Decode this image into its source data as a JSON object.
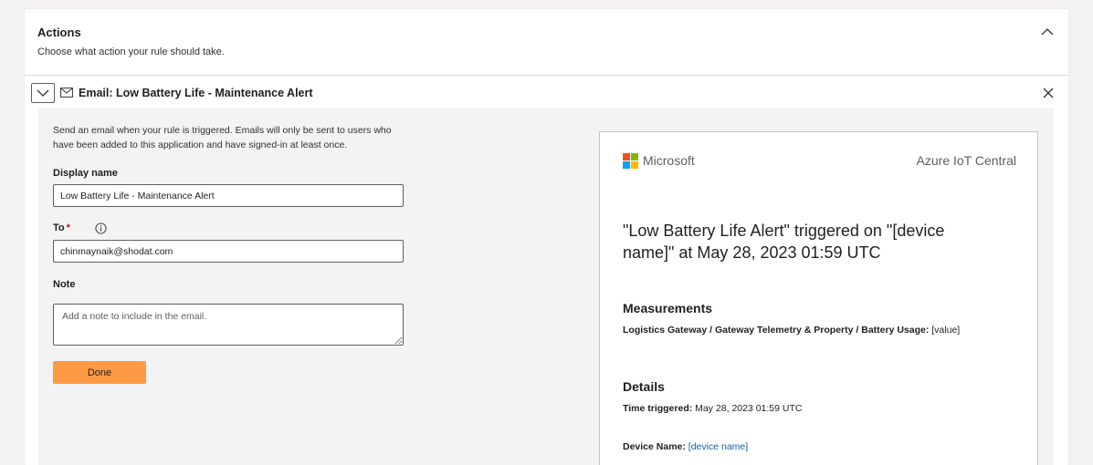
{
  "actions": {
    "title": "Actions",
    "subtitle": "Choose what action your rule should take."
  },
  "email_action": {
    "title": "Email: Low Battery Life - Maintenance Alert",
    "description": "Send an email when your rule is triggered. Emails will only be sent to users who have been added to this application and have signed-in at least once.",
    "display_name_label": "Display name",
    "display_name_value": "Low Battery Life - Maintenance Alert",
    "to_label": "To",
    "to_required": "*",
    "to_value": "chinmaynaik@shodat.com",
    "note_label": "Note",
    "note_placeholder": "Add a note to include in the email.",
    "done_label": "Done"
  },
  "preview": {
    "ms_name": "Microsoft",
    "brand": "Azure IoT Central",
    "headline": "\"Low Battery Life Alert\" triggered on \"[device name]\" at May 28, 2023 01:59 UTC",
    "measurements_title": "Measurements",
    "measurement_label": "Logistics Gateway / Gateway Telemetry & Property / Battery Usage:",
    "measurement_value": "[value]",
    "details_title": "Details",
    "time_label": "Time triggered:",
    "time_value": "May 28, 2023 01:59 UTC",
    "device_label": "Device Name:",
    "device_value": "[device name]"
  },
  "colors": {
    "accent_button": "#ff9a44",
    "link": "#0f5fae",
    "required": "#a4262c",
    "ms_red": "#f25022",
    "ms_green": "#7fba00",
    "ms_blue": "#00a4ef",
    "ms_yellow": "#ffb900"
  },
  "icons": {
    "collapse": "chevron-up-icon",
    "expand": "chevron-down-icon",
    "mail": "mail-icon",
    "close": "close-icon",
    "info": "info-icon"
  }
}
